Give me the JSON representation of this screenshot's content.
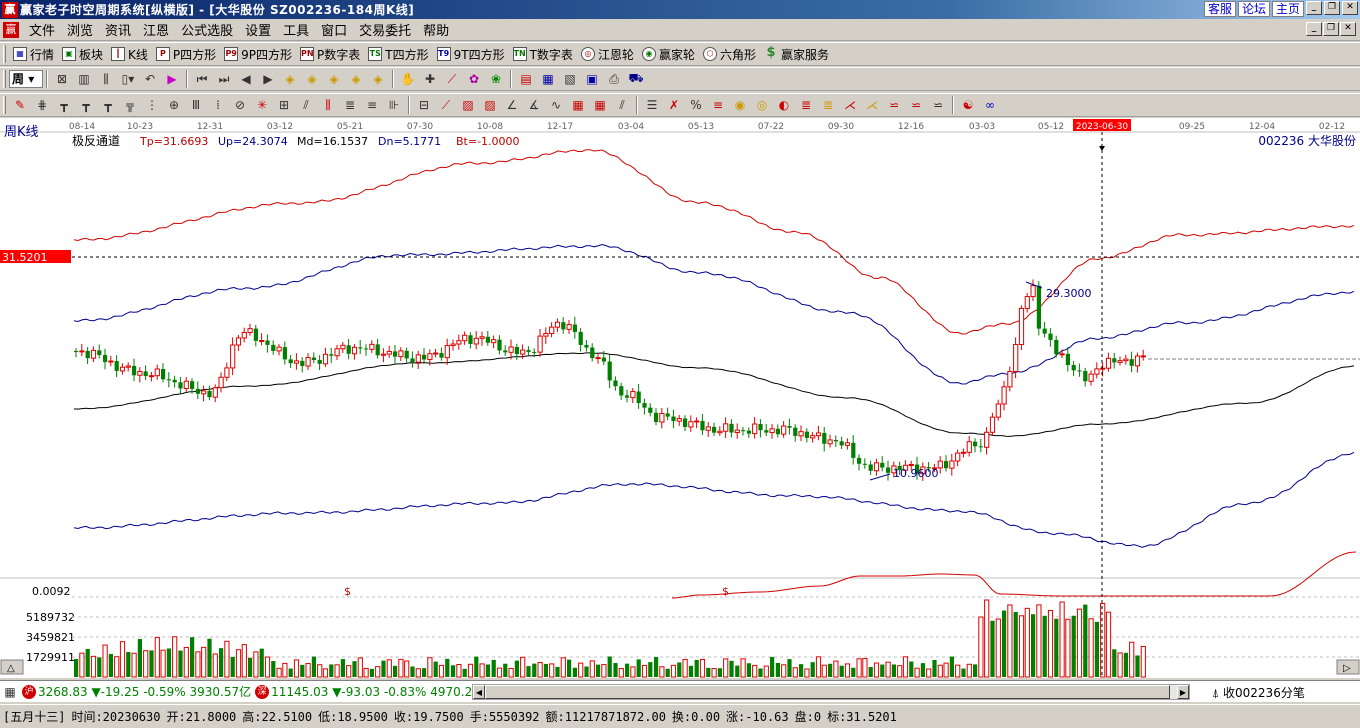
{
  "window": {
    "title": "赢家老子时空周期系统[纵横版] - [大华股份  SZ002236-184周K线]",
    "links": [
      "客服",
      "论坛",
      "主页"
    ]
  },
  "menu": [
    "文件",
    "浏览",
    "资讯",
    "江恩",
    "公式选股",
    "设置",
    "工具",
    "窗口",
    "交易委托",
    "帮助"
  ],
  "toolbar1": [
    {
      "label": "行情",
      "icon": "grid-icon"
    },
    {
      "label": "板块",
      "icon": "blocks-icon"
    },
    {
      "label": "K线",
      "icon": "candles-icon"
    },
    {
      "label": "P四方形",
      "icon": "P"
    },
    {
      "label": "9P四方形",
      "icon": "P9"
    },
    {
      "label": "P数字表",
      "icon": "PN"
    },
    {
      "label": "T四方形",
      "icon": "TS"
    },
    {
      "label": "9T四方形",
      "icon": "T9"
    },
    {
      "label": "T数字表",
      "icon": "TN"
    },
    {
      "label": "江恩轮",
      "icon": "wheel"
    },
    {
      "label": "赢家轮",
      "icon": "wheel2"
    },
    {
      "label": "六角形",
      "icon": "hexagon"
    },
    {
      "label": "赢家服务",
      "icon": "$"
    }
  ],
  "period": "周",
  "chart_header": {
    "period_label": "周K线",
    "indicator": "极反通道",
    "tp": "Tp=31.6693",
    "up": "Up=24.3074",
    "md": "Md=16.1537",
    "dn": "Dn=5.1771",
    "bt": "Bt=-1.0000",
    "stock": "002236  大华股份",
    "price_marker": "31.5201",
    "vol_ref": "0.0092",
    "vol_labels": [
      "5189732",
      "3459821",
      "1729911"
    ],
    "annot_high": "29.3000",
    "annot_low": "10.9600",
    "date_labels": [
      "08-14",
      "10-23",
      "12-31",
      "03-12",
      "05-21",
      "07-30",
      "10-08",
      "12-17",
      "03-04",
      "05-13",
      "07-22",
      "09-30",
      "12-16",
      "03-03",
      "05-12",
      "2023-06-30",
      "09-25",
      "12-04",
      "02-12"
    ]
  },
  "ticker": {
    "sh_badge": "沪",
    "sh_value": "3268.83",
    "sh_change": "▼-19.25",
    "sh_pct": "-0.59%",
    "sh_amount": "3930.57亿",
    "sz_badge": "深",
    "sz_value": "11145.03",
    "sz_change": "▼-93.03",
    "sz_pct": "-0.83%",
    "sz_amount": "4970.2",
    "ticks_label": "收002236分笔"
  },
  "status": {
    "lunar": "[五月十三]",
    "time": "时间:20230630",
    "open": "开:21.8000",
    "high": "高:22.5100",
    "low": "低:18.9500",
    "close": "收:19.7500",
    "hand": "手:5550392",
    "amount": "额:11217871872.00",
    "turnover": "换:0.00",
    "change": "涨:-10.63",
    "disk": "盘:0",
    "mark": "标:31.5201"
  },
  "colors": {
    "up": "#e00000",
    "down": "#008000",
    "upper_band": "#d00000",
    "mid_band": "#000000",
    "lower_band": "#00008b",
    "marker_bg": "#ff0000"
  }
}
